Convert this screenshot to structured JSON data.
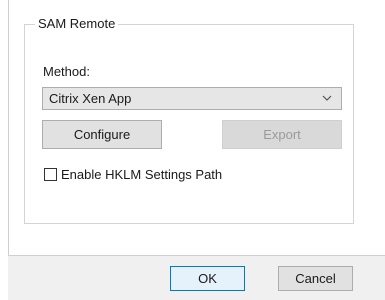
{
  "group": {
    "title": "SAM Remote"
  },
  "method": {
    "label": "Method:",
    "selected": "Citrix Xen App",
    "icon": "chevron-down-icon"
  },
  "buttons": {
    "configure": "Configure",
    "export": "Export",
    "ok": "OK",
    "cancel": "Cancel"
  },
  "checkbox": {
    "label": "Enable HKLM Settings Path",
    "checked": false
  },
  "colors": {
    "ok_border": "#0078d7",
    "disabled_text": "#9a9a9a",
    "footer_bg": "#f0f0f0"
  }
}
